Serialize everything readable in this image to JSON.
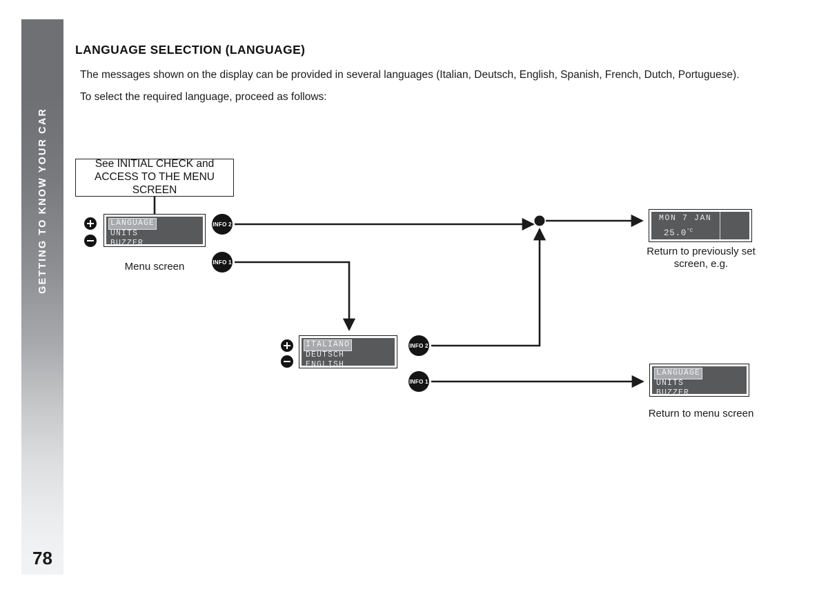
{
  "side_tab": {
    "label": "GETTING TO KNOW YOUR CAR",
    "page_number": "78",
    "gradient_top": "#6e7073",
    "gradient_bottom": "#f2f3f4"
  },
  "heading": "LANGUAGE SELECTION (LANGUAGE)",
  "paragraphs": [
    "The messages shown on the display can be provided in several languages (Italian, Deutsch, English, Spanish, French, Dutch, Portuguese).",
    "To select the required language, proceed as follows:"
  ],
  "flow": {
    "initial_check_box": "See INITIAL CHECK and ACCESS TO THE MENU SCREEN",
    "menu_display": {
      "items": [
        "LANGUAGE",
        "UNITS",
        "BUZZER"
      ],
      "selected_index": 0,
      "caption": "Menu screen",
      "screen_color": "#58595b",
      "text_color": "#e6e7e8",
      "highlight_color": "#a7a9ac"
    },
    "language_display": {
      "items": [
        "ITALIANO",
        "DEUTSCH",
        "ENGLISH"
      ],
      "selected_index": 0
    },
    "clock_display": {
      "date": "MON 7 JAN",
      "temperature": "25.0",
      "temperature_unit": "°C",
      "caption": "Return to previously set screen, e.g."
    },
    "menu_display_return": {
      "items": [
        "LANGUAGE",
        "UNITS",
        "BUZZER"
      ],
      "selected_index": 0,
      "caption": "Return to menu screen"
    },
    "badges": {
      "info2_top": "INFO 2",
      "info1_top": "INFO 1",
      "info2_bottom": "INFO 2",
      "info1_bottom": "INFO 1",
      "plus": "+",
      "minus": "-"
    }
  }
}
